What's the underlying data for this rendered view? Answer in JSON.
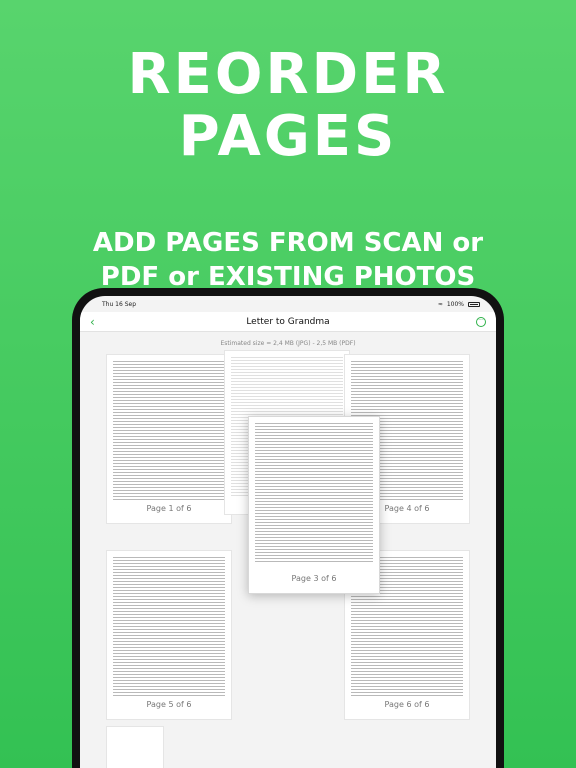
{
  "headline": {
    "line1": "REORDER",
    "line2": "PAGES"
  },
  "subhead": {
    "line1": "ADD PAGES FROM SCAN or",
    "line2": "PDF or EXISTING PHOTOS"
  },
  "status": {
    "time": "Thu 16 Sep",
    "battery": "100%"
  },
  "nav": {
    "title": "Letter to Grandma",
    "back_icon": "chevron-left-icon",
    "more_icon": "ellipsis-circle-icon",
    "more_glyph": "···"
  },
  "size_info": "Estimated size = 2,4 MB (JPG) - 2,5 MB (PDF)",
  "pages": [
    {
      "label": "Page 1 of 6"
    },
    {
      "label": "Page 3 of 6"
    },
    {
      "label": "Page 4 of 6"
    },
    {
      "label": "Page 5 of 6"
    },
    {
      "label": "Page 6 of 6"
    }
  ],
  "colors": {
    "accent": "#2fb24a",
    "background": "#3fc85b"
  }
}
